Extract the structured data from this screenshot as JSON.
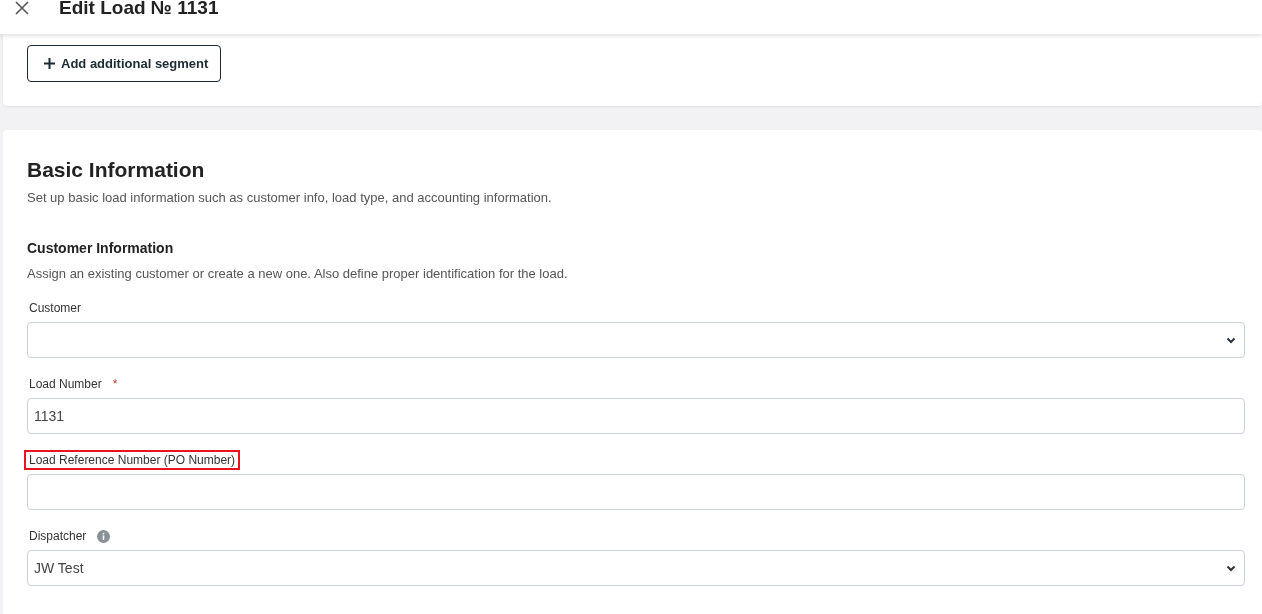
{
  "header": {
    "title": "Edit Load № 1131"
  },
  "segment_button": {
    "label": "Add additional segment"
  },
  "basic_information": {
    "title": "Basic Information",
    "description": "Set up basic load information such as customer info, load type, and accounting information.",
    "customer_information": {
      "title": "Customer Information",
      "description": "Assign an existing customer or create a new one. Also define proper identification for the load.",
      "fields": [
        {
          "kind": "select",
          "label": "Customer",
          "info": false,
          "highlighted": false
        },
        {
          "kind": "text",
          "label": "Load Number",
          "value": "1131",
          "required_mark": "*",
          "info": false,
          "highlighted": false
        },
        {
          "kind": "text",
          "label": "Load Reference Number (PO Number)",
          "info": false,
          "highlighted": true
        },
        {
          "kind": "select",
          "label": "Dispatcher",
          "value": "JW Test",
          "info": true,
          "highlighted": false
        }
      ]
    }
  }
}
